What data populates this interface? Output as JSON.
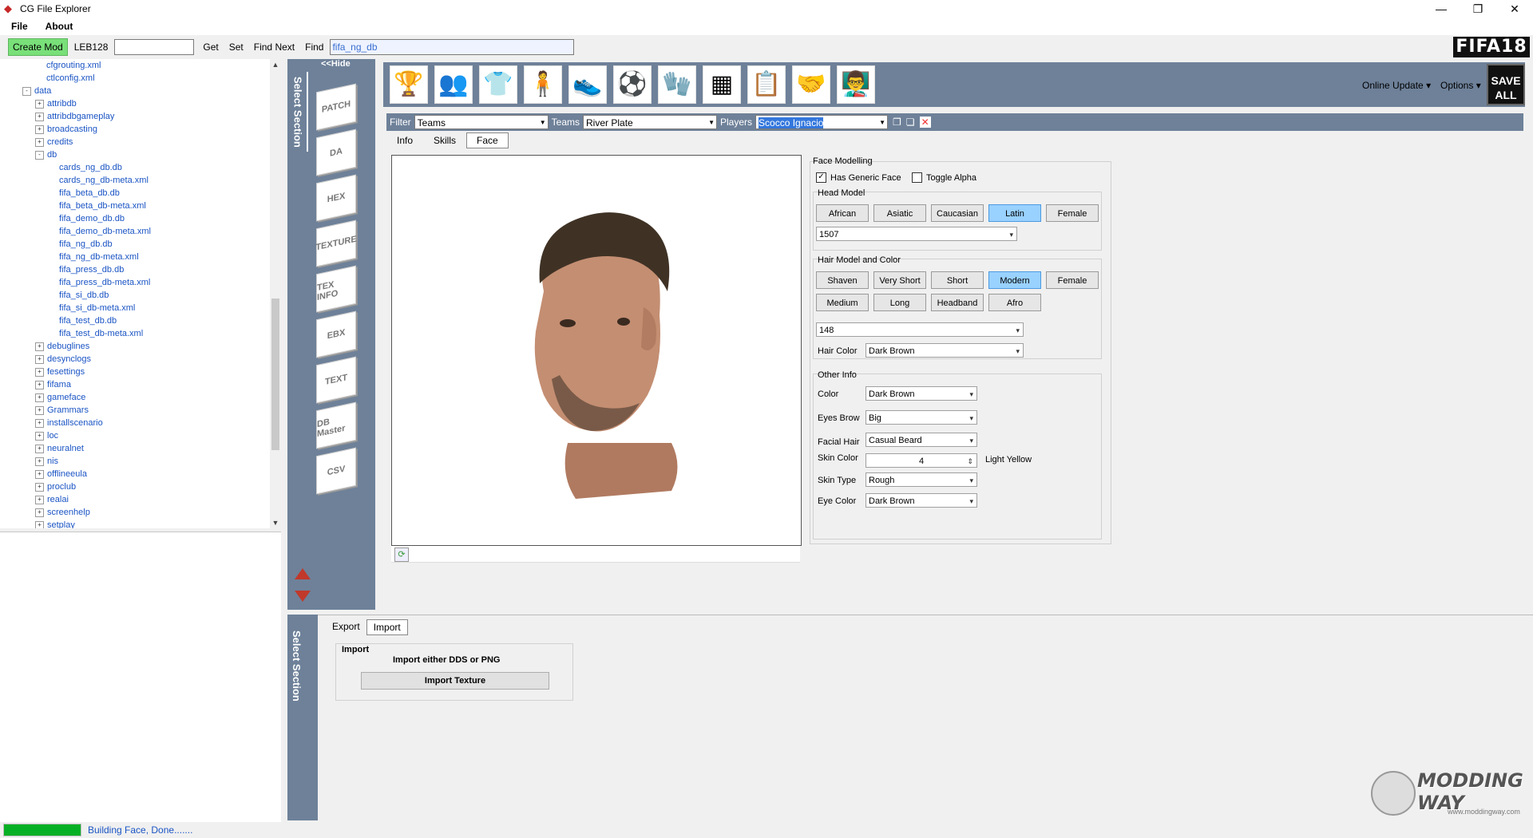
{
  "window": {
    "title": "CG File Explorer",
    "minimize": "—",
    "maximize": "❐",
    "close": "✕"
  },
  "menu": {
    "file": "File",
    "about": "About"
  },
  "toolbar": {
    "create_mod": "Create Mod",
    "leb_label": "LEB128",
    "get": "Get",
    "set": "Set",
    "find_next": "Find Next",
    "find": "Find",
    "find_value": "fifa_ng_db"
  },
  "logo": "FIFA18",
  "tree": {
    "items": [
      {
        "label": "cfgrouting.xml",
        "indent": 1,
        "toggle": ""
      },
      {
        "label": "ctlconfig.xml",
        "indent": 1,
        "toggle": ""
      },
      {
        "label": "data",
        "indent": 0,
        "toggle": "-"
      },
      {
        "label": "attribdb",
        "indent": 1,
        "toggle": "+"
      },
      {
        "label": "attribdbgameplay",
        "indent": 1,
        "toggle": "+"
      },
      {
        "label": "broadcasting",
        "indent": 1,
        "toggle": "+"
      },
      {
        "label": "credits",
        "indent": 1,
        "toggle": "+"
      },
      {
        "label": "db",
        "indent": 1,
        "toggle": "-"
      },
      {
        "label": "cards_ng_db.db",
        "indent": 2,
        "toggle": ""
      },
      {
        "label": "cards_ng_db-meta.xml",
        "indent": 2,
        "toggle": ""
      },
      {
        "label": "fifa_beta_db.db",
        "indent": 2,
        "toggle": ""
      },
      {
        "label": "fifa_beta_db-meta.xml",
        "indent": 2,
        "toggle": ""
      },
      {
        "label": "fifa_demo_db.db",
        "indent": 2,
        "toggle": ""
      },
      {
        "label": "fifa_demo_db-meta.xml",
        "indent": 2,
        "toggle": ""
      },
      {
        "label": "fifa_ng_db.db",
        "indent": 2,
        "toggle": ""
      },
      {
        "label": "fifa_ng_db-meta.xml",
        "indent": 2,
        "toggle": ""
      },
      {
        "label": "fifa_press_db.db",
        "indent": 2,
        "toggle": ""
      },
      {
        "label": "fifa_press_db-meta.xml",
        "indent": 2,
        "toggle": ""
      },
      {
        "label": "fifa_si_db.db",
        "indent": 2,
        "toggle": ""
      },
      {
        "label": "fifa_si_db-meta.xml",
        "indent": 2,
        "toggle": ""
      },
      {
        "label": "fifa_test_db.db",
        "indent": 2,
        "toggle": ""
      },
      {
        "label": "fifa_test_db-meta.xml",
        "indent": 2,
        "toggle": ""
      },
      {
        "label": "debuglines",
        "indent": 1,
        "toggle": "+"
      },
      {
        "label": "desynclogs",
        "indent": 1,
        "toggle": "+"
      },
      {
        "label": "fesettings",
        "indent": 1,
        "toggle": "+"
      },
      {
        "label": "fifama",
        "indent": 1,
        "toggle": "+"
      },
      {
        "label": "gameface",
        "indent": 1,
        "toggle": "+"
      },
      {
        "label": "Grammars",
        "indent": 1,
        "toggle": "+"
      },
      {
        "label": "installscenario",
        "indent": 1,
        "toggle": "+"
      },
      {
        "label": "loc",
        "indent": 1,
        "toggle": "+"
      },
      {
        "label": "neuralnet",
        "indent": 1,
        "toggle": "+"
      },
      {
        "label": "nis",
        "indent": 1,
        "toggle": "+"
      },
      {
        "label": "offlineeula",
        "indent": 1,
        "toggle": "+"
      },
      {
        "label": "proclub",
        "indent": 1,
        "toggle": "+"
      },
      {
        "label": "realai",
        "indent": 1,
        "toggle": "+"
      },
      {
        "label": "screenhelp",
        "indent": 1,
        "toggle": "+"
      },
      {
        "label": "setplay",
        "indent": 1,
        "toggle": "+"
      }
    ]
  },
  "status": {
    "text": "Building Face, Done.......",
    "progress": 1.0
  },
  "sections": {
    "select_section": "Select Section",
    "hide": "<<Hide",
    "items": [
      "PATCH",
      "DA",
      "HEX",
      "TEXTURE",
      "TEX INFO",
      "EBX",
      "TEXT",
      "DB Master",
      "CSV"
    ]
  },
  "header_icons": [
    "trophy-icon",
    "players-icon",
    "kit-icon",
    "player-figure-icon",
    "boot-icon",
    "ball-icon",
    "gloves-icon",
    "board-icon",
    "tactics-icon",
    "handshake-icon",
    "coach-icon"
  ],
  "header": {
    "online_update": "Online Update",
    "options": "Options",
    "save_all": "SAVE ALL"
  },
  "filters": {
    "filter_label": "Filter",
    "filter_value": "Teams",
    "teams_label": "Teams",
    "teams_value": "River Plate",
    "players_label": "Players",
    "players_value": "Scocco Ignacio"
  },
  "tabs": [
    "Info",
    "Skills",
    "Face"
  ],
  "face": {
    "title": "Face Modelling",
    "has_generic_face": "Has Generic Face",
    "toggle_alpha": "Toggle Alpha",
    "head_model_title": "Head Model",
    "head_buttons": [
      "African",
      "Asiatic",
      "Caucasian",
      "Latin",
      "Female"
    ],
    "head_selected": "Latin",
    "head_value": "1507",
    "hair_title": "Hair Model and Color",
    "hair_buttons_row1": [
      "Shaven",
      "Very Short",
      "Short",
      "Modern",
      "Female"
    ],
    "hair_buttons_row2": [
      "Medium",
      "Long",
      "Headband",
      "Afro"
    ],
    "hair_selected": "Modern",
    "hair_value": "148",
    "hair_color_label": "Hair Color",
    "hair_color_value": "Dark Brown",
    "other_title": "Other Info",
    "color_label": "Color",
    "color_value": "Dark Brown",
    "eyes_brow_label": "Eyes Brow",
    "eyes_brow_value": "Big",
    "facial_hair_label": "Facial Hair",
    "facial_hair_value": "Casual Beard",
    "skin_color_label": "Skin Color",
    "skin_color_value": "4",
    "skin_color_name": "Light Yellow",
    "skin_type_label": "Skin Type",
    "skin_type_value": "Rough",
    "eye_color_label": "Eye Color",
    "eye_color_value": "Dark Brown"
  },
  "import": {
    "tabs": [
      "Export",
      "Import"
    ],
    "group_title": "Import",
    "description": "Import either DDS or PNG",
    "button": "Import Texture"
  },
  "watermark": {
    "name": "MODDING WAY",
    "url": "www.moddingway.com"
  },
  "colors": {
    "accent_panel": "#6e8199",
    "selected_button": "#99d1ff",
    "create_mod": "#79e079",
    "link": "#1a54c4"
  }
}
